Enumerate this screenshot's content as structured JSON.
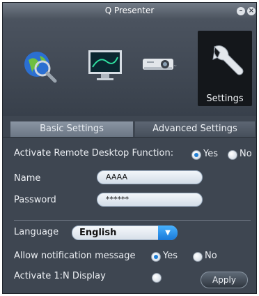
{
  "window": {
    "title": "Q Presenter"
  },
  "titlebar": {
    "minimize_glyph": "–",
    "close_glyph": "×"
  },
  "nav": {
    "items": [
      {
        "icon": "globe-search-icon"
      },
      {
        "icon": "monitor-icon"
      },
      {
        "icon": "projector-icon"
      },
      {
        "icon": "wrench-icon",
        "label": "Settings",
        "selected": true
      }
    ]
  },
  "tabs": {
    "basic": "Basic Settings",
    "advanced": "Advanced Settings",
    "active": "basic"
  },
  "remote_desktop": {
    "label": "Activate Remote Desktop Function:",
    "yes": "Yes",
    "no": "No",
    "selected": "yes"
  },
  "name": {
    "label": "Name",
    "value": "AAAA"
  },
  "password": {
    "label": "Password",
    "value": "******"
  },
  "language": {
    "label": "Language",
    "value": "English"
  },
  "notification": {
    "label": "Allow notification message",
    "yes": "Yes",
    "no": "No",
    "selected": "yes"
  },
  "one_to_n": {
    "label": "Activate 1:N Display",
    "checked": false
  },
  "apply": {
    "label": "Apply"
  },
  "colors": {
    "accent": "#1f7fd6",
    "window_bg": "#3e4651",
    "settings_tile": "#14171b"
  }
}
